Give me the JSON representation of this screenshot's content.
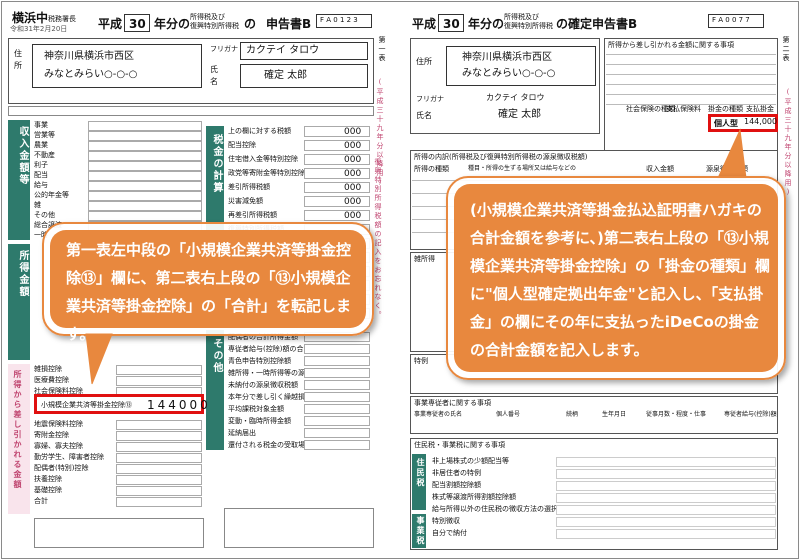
{
  "left_form": {
    "office": "横浜中",
    "office_suffix": "税務署長",
    "date_line": "令和31年2月20日",
    "year_prefix": "平成",
    "year": "30",
    "title_mid": "年分の",
    "title_small1": "所得税及び",
    "title_small2": "復興特別所得税",
    "title_suffix": "の",
    "form_name": "申告書B",
    "form_code": "F A 0 1 2 3",
    "address_label1": "住",
    "address_label2": "所",
    "address_line1": "神奈川県横浜市西区",
    "address_line2": "みなとみらい○-○-○",
    "furigana_label": "フリガナ",
    "furigana": "カクテイ タロウ",
    "name_label1": "氏",
    "name_label2": "名",
    "name": "確定 太郎",
    "section_income": "収入金額等",
    "section_shotoku": "所得金額",
    "section_deduction": "所得から差し引かれる金額",
    "section_tax": "税金の計算",
    "section_other": "その他",
    "income_rows": [
      "事業",
      "営業等",
      "農業",
      "不動産",
      "利子",
      "配当",
      "給与",
      "公的年金等",
      "雑",
      "その他",
      "総合譲渡",
      "一時"
    ],
    "deduction_rows": [
      "雑損控除",
      "医療費控除",
      "社会保険料控除",
      "小規模企業共済等掛金控除",
      "生命保険料控除",
      "地震保険料控除",
      "寄附金控除",
      "寡婦、寡夫控除",
      "勤労学生、障害者控除",
      "配偶者(特別)控除",
      "扶養控除",
      "基礎控除",
      "合計"
    ],
    "tax_rows": [
      "上の欄に対する税額",
      "配当控除",
      "住宅借入金等特別控除",
      "政党等寄附金等特別控除",
      "差引所得税額",
      "災害減免額",
      "再差引所得税額",
      "復興特別所得税額",
      "所得税及び復興特別所得税の額",
      "外国税額控除",
      "源泉徴収税額",
      "申告納税額",
      "予定納税額",
      "第3期分の税額"
    ],
    "other_rows": [
      "配偶者の合計所得金額",
      "専従者給与(控除)額の合計額",
      "青色申告特別控除額",
      "雑所得・一時所得等の源泉徴収税額の合計額",
      "未納付の源泉徴収税額",
      "本年分で差し引く繰越損失額",
      "平均課税対象金額",
      "変動・臨時所得金額",
      "延納届出",
      "還付される税金の受取場所"
    ],
    "highlight_label": "小規模企業共済等掛金控除",
    "highlight_num": "⑬",
    "highlight_value": "144000",
    "zero_values": [
      "000",
      "000",
      "000",
      "000",
      "000",
      "000",
      "000"
    ],
    "side_text": "(平成三十九年分以降用)",
    "margin_right_text": "第一表",
    "vertical_pink": "復興特別所得税額の記入をお忘れなく。"
  },
  "right_form": {
    "year_prefix": "平成",
    "year": "30",
    "title_mid": "年分の",
    "title_small1": "所得税及び",
    "title_small2": "復興特別所得税",
    "title_suffix": "の確定申告書B",
    "form_code": "F A 0 0 7 7",
    "section_deduction_title": "所得から差し引かれる金額に関する事項",
    "address_label": "住所",
    "address_line1": "神奈川県横浜市西区",
    "address_line2": "みなとみらい○-○-○",
    "furigana_label": "フリガナ",
    "furigana": "カクテイ タロウ",
    "name_label": "氏名",
    "name": "確定 太郎",
    "deduction_col1": "社会保険の種類",
    "deduction_col2": "支払保険料",
    "deduction_col3": "掛金の種類",
    "deduction_col4": "支払掛金",
    "kind_value": "個人型",
    "kind_amount": "144,000",
    "margin_text": "第二表",
    "side_text": "(平成三十九年分以降用)",
    "section_breakdown": "所得の内訳(所得税及び復興特別所得税の源泉徴収税額)",
    "breakdown_cols": [
      "所得の種類",
      "種目・所得の生ずる場所又は給与などの支払者の氏名・名称",
      "収入金額",
      "源泉徴収税額"
    ],
    "section_misc": "雑所得",
    "section_special": "特例",
    "section_business": "事業専従者に関する事項",
    "business_cols": [
      "事業専従者の氏名",
      "個人番号",
      "続柄",
      "生年月日",
      "従事月数・程度・仕事の内容",
      "専従者給与(控除)額"
    ],
    "section_resident": "住民税・事業税に関する事項",
    "resident_side": "住民税",
    "resident_rows": [
      "非上場株式の少額配当等",
      "非居住者の特例",
      "配当割額控除額",
      "株式等譲渡所得割額控除額",
      "給与所得以外の住民税の徴収方法の選択",
      "特別徴収",
      "自分で納付"
    ],
    "business_side": "事業税"
  },
  "callouts": {
    "left": "第一表左中段の「小規模企業共済等掛金控除⑬」欄に、第二表右上段の「⑬小規模企業共済等掛金控除」の「合計」を転記します。",
    "right": "(小規模企業共済等掛金払込証明書ハガキの合計金額を参考に、)第二表右上段の「⑬小規模企業共済等掛金控除」の「掛金の種類」欄に\"個人型確定拠出年金\"と記入し、「支払掛金」の欄にその年に支払ったiDeCoの掛金の合計金額を記入します。"
  },
  "colors": {
    "accent": "#e8883e",
    "highlight": "#e01010",
    "form_green": "#2e7a6c",
    "form_pink": "#f9e4ec"
  }
}
